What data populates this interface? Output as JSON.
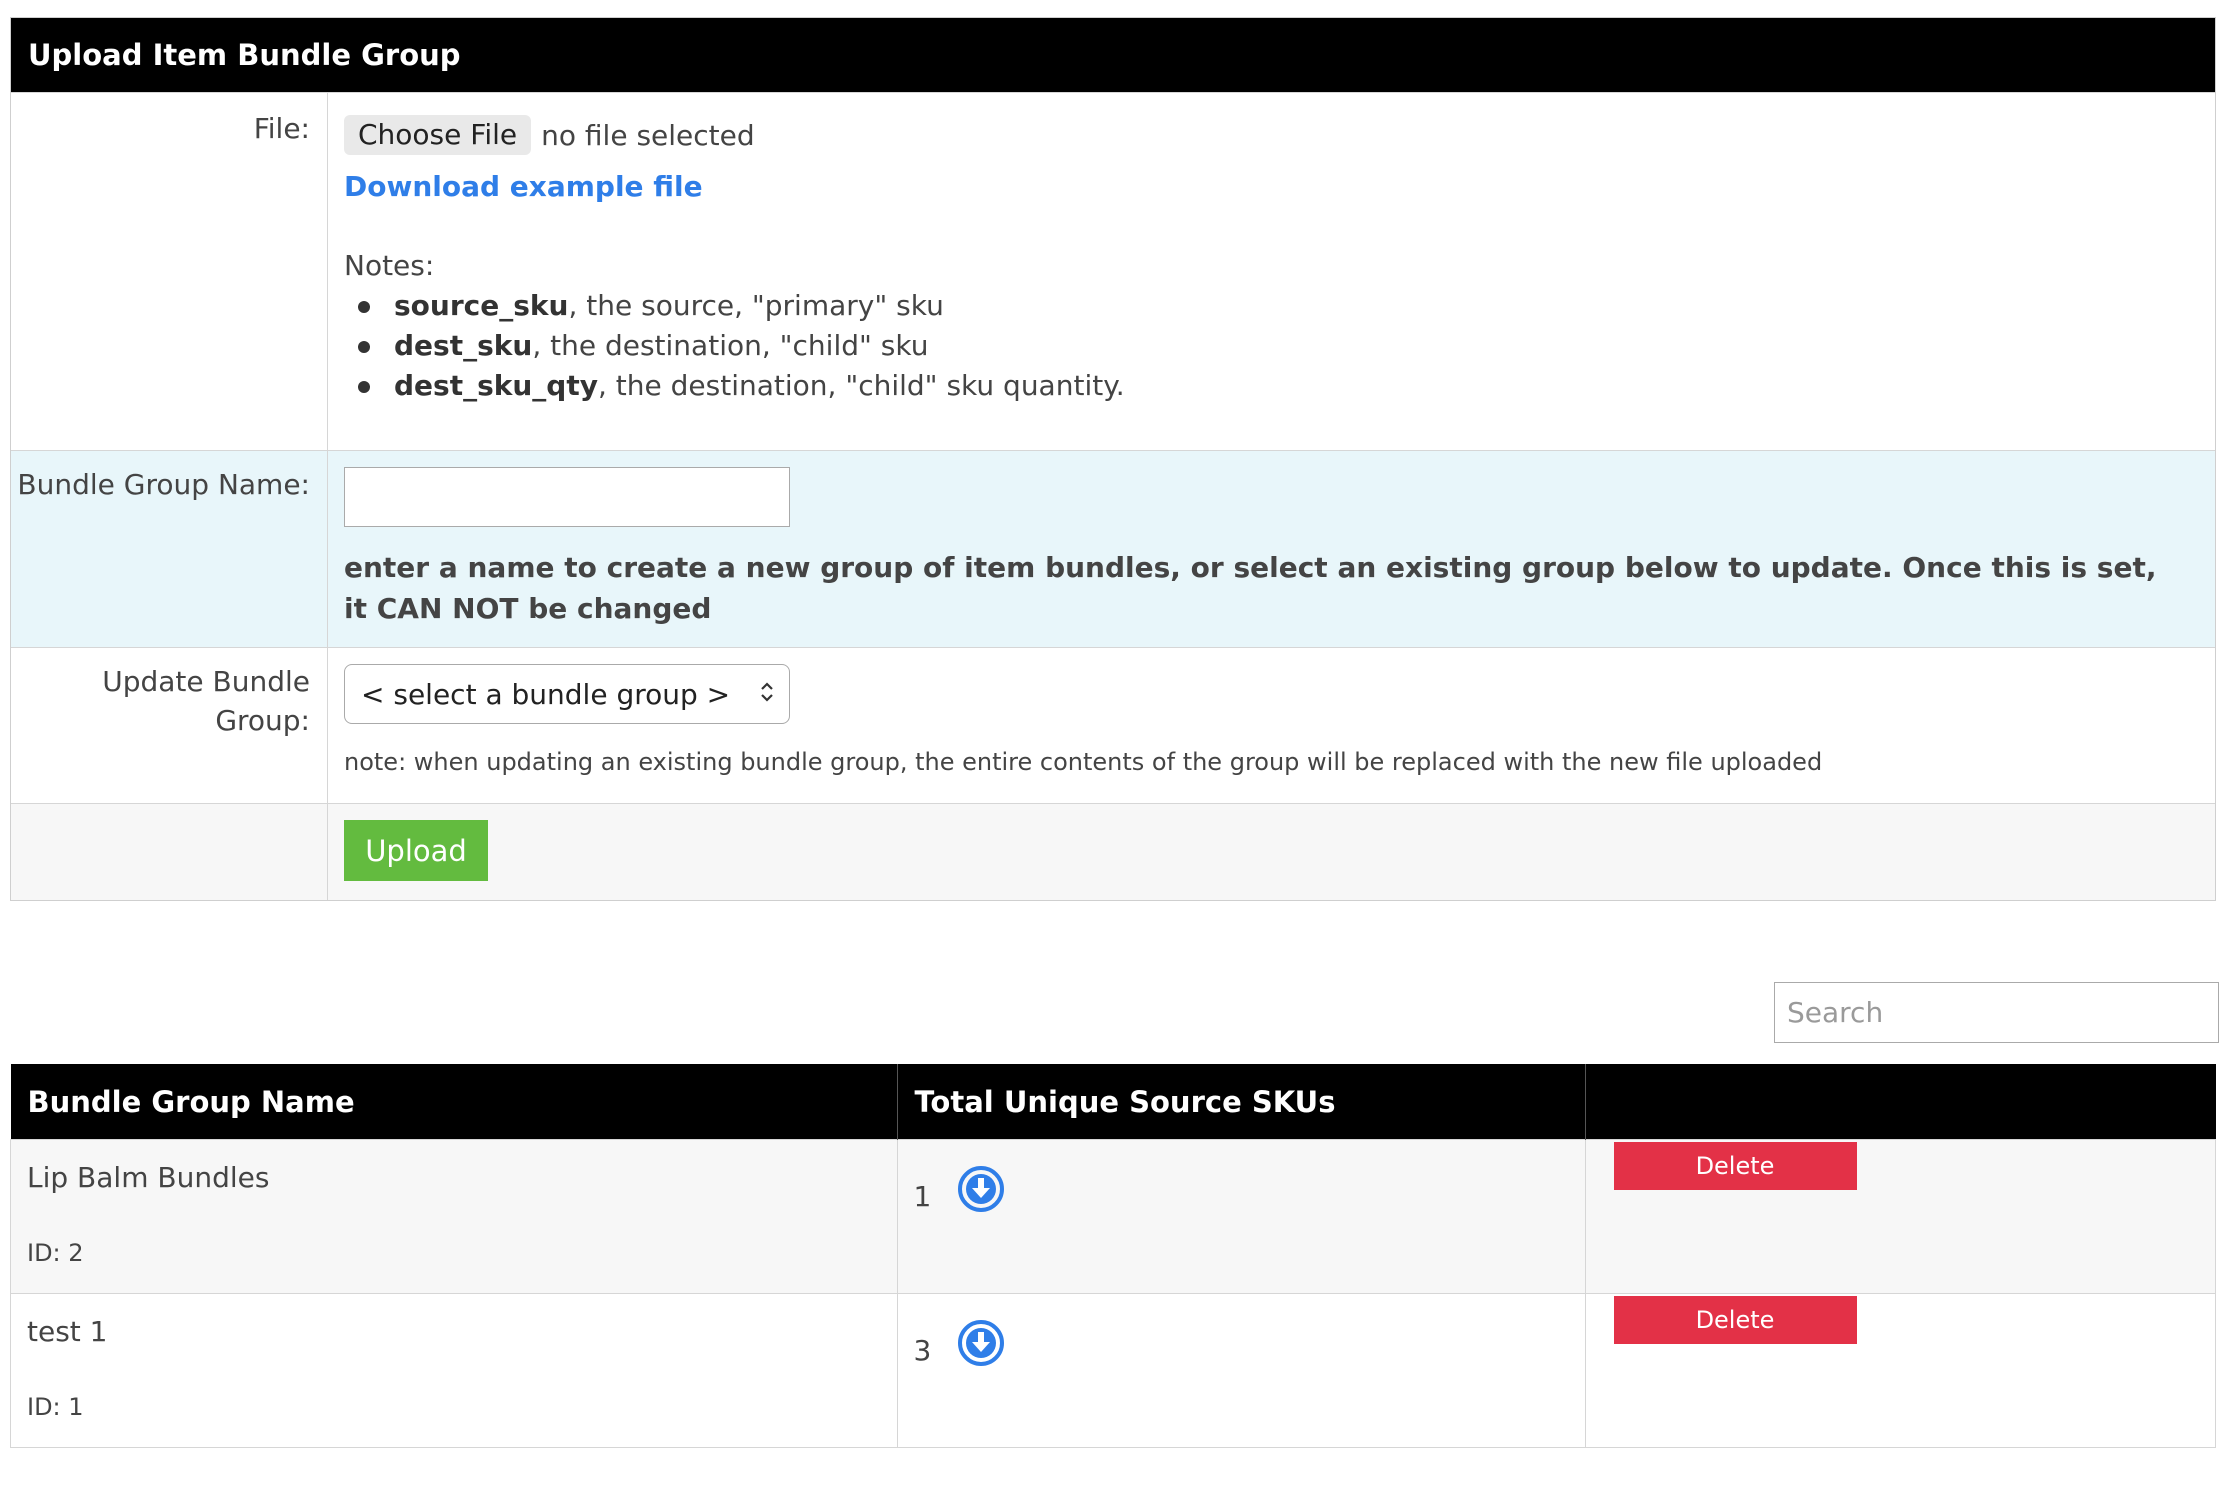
{
  "upload_panel": {
    "title": "Upload Item Bundle Group",
    "file": {
      "label": "File:",
      "choose_button": "Choose File",
      "status": "no file selected",
      "download_link": "Download example file",
      "notes_title": "Notes:",
      "notes": [
        {
          "field": "source_sku",
          "text": ", the source, \"primary\" sku"
        },
        {
          "field": "dest_sku",
          "text": ", the destination, \"child\" sku"
        },
        {
          "field": "dest_sku_qty",
          "text": ", the destination, \"child\" sku quantity."
        }
      ]
    },
    "bundle_name": {
      "label": "Bundle Group Name:",
      "value": "",
      "help": "enter a name to create a new group of item bundles, or select an existing group below to update. Once this is set, it CAN NOT be changed"
    },
    "update_group": {
      "label": "Update Bundle Group:",
      "selected": "< select a bundle group >",
      "note": "note: when updating an existing bundle group, the entire contents of the group will be replaced with the new file uploaded"
    },
    "upload_button": "Upload"
  },
  "search": {
    "placeholder": "Search"
  },
  "groups_table": {
    "columns": [
      "Bundle Group Name",
      "Total Unique Source SKUs",
      ""
    ],
    "rows": [
      {
        "name": "Lip Balm Bundles",
        "id_text": "ID: 2",
        "skus": "1",
        "delete_label": "Delete"
      },
      {
        "name": "test 1",
        "id_text": "ID: 1",
        "skus": "3",
        "delete_label": "Delete"
      }
    ]
  },
  "colors": {
    "header_bg": "#000000",
    "link": "#2f7ee8",
    "upload_btn": "#63bb3f",
    "delete_btn": "#e33147",
    "name_row_bg": "#e8f6fa",
    "download_icon": "#2f7ee8"
  },
  "icons": {
    "download": "download-circle-icon",
    "select_chevron": "chevron-up-down-icon"
  }
}
